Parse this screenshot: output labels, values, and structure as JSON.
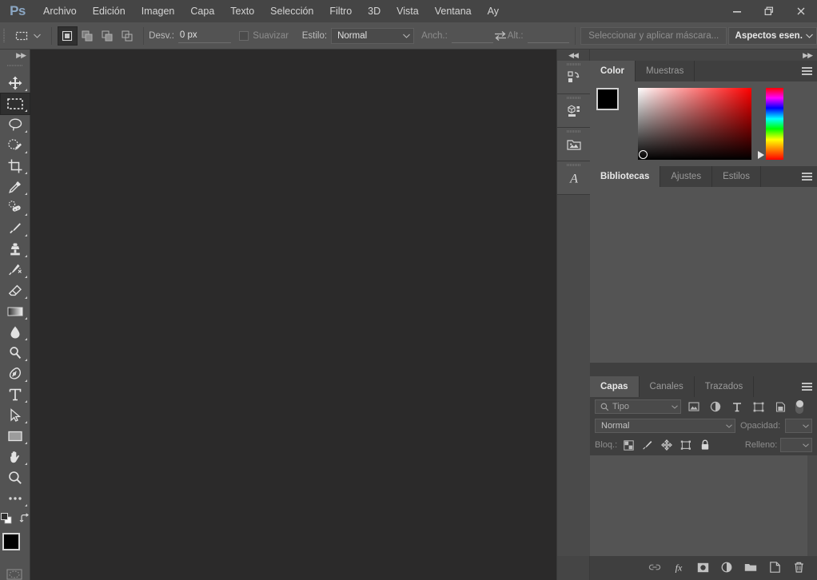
{
  "app": {
    "logo": "Ps",
    "accent_color": "#8ba7c4",
    "chrome_color": "#535353",
    "panel_color": "#545454",
    "canvas_color": "#2b2a2a"
  },
  "menubar": {
    "items": [
      {
        "label": "Archivo",
        "name": "menu-archivo"
      },
      {
        "label": "Edición",
        "name": "menu-edicion"
      },
      {
        "label": "Imagen",
        "name": "menu-imagen"
      },
      {
        "label": "Capa",
        "name": "menu-capa"
      },
      {
        "label": "Texto",
        "name": "menu-texto"
      },
      {
        "label": "Selección",
        "name": "menu-seleccion"
      },
      {
        "label": "Filtro",
        "name": "menu-filtro"
      },
      {
        "label": "3D",
        "name": "menu-3d"
      },
      {
        "label": "Vista",
        "name": "menu-vista"
      },
      {
        "label": "Ventana",
        "name": "menu-ventana"
      },
      {
        "label": "Ay",
        "name": "menu-ayuda"
      }
    ]
  },
  "window_controls": {
    "minimize": "minimize-icon",
    "restore": "restore-icon",
    "close": "close-icon"
  },
  "options_bar": {
    "tool_preset_icon": "rectangular-marquee-icon",
    "selection_modes": [
      {
        "name": "new-selection",
        "active": true
      },
      {
        "name": "add-to-selection",
        "active": false
      },
      {
        "name": "subtract-from-selection",
        "active": false
      },
      {
        "name": "intersect-selection",
        "active": false
      }
    ],
    "feather_label": "Desv.:",
    "feather_value": "0 px",
    "antialias_label": "Suavizar",
    "antialias_checked": false,
    "style_label": "Estilo:",
    "style_value": "Normal",
    "width_label": "Anch.:",
    "width_value": "",
    "height_label": "Alt.:",
    "height_value": "",
    "swap_icon": "swap-dimensions-icon",
    "select_and_mask_label": "Seleccionar y aplicar máscara...",
    "workspace_label": "Aspectos esen."
  },
  "toolbar": {
    "collapse_icon": "collapse-double-arrow-icon",
    "tools": [
      {
        "name": "move-tool",
        "label": "Mover",
        "selected": false,
        "has_flyout": true
      },
      {
        "name": "rectangular-marquee-tool",
        "label": "Marco rectangular",
        "selected": true,
        "has_flyout": true
      },
      {
        "name": "lasso-tool",
        "label": "Lazo",
        "selected": false,
        "has_flyout": true
      },
      {
        "name": "quick-selection-tool",
        "label": "Selección rápida",
        "selected": false,
        "has_flyout": true
      },
      {
        "name": "crop-tool",
        "label": "Recortar",
        "selected": false,
        "has_flyout": true
      },
      {
        "name": "eyedropper-tool",
        "label": "Cuentagotas",
        "selected": false,
        "has_flyout": true
      },
      {
        "name": "healing-brush-tool",
        "label": "Pincel corrector",
        "selected": false,
        "has_flyout": true
      },
      {
        "name": "brush-tool",
        "label": "Pincel",
        "selected": false,
        "has_flyout": true
      },
      {
        "name": "clone-stamp-tool",
        "label": "Tampón de clonar",
        "selected": false,
        "has_flyout": true
      },
      {
        "name": "history-brush-tool",
        "label": "Pincel de historia",
        "selected": false,
        "has_flyout": true
      },
      {
        "name": "eraser-tool",
        "label": "Borrador",
        "selected": false,
        "has_flyout": true
      },
      {
        "name": "gradient-tool",
        "label": "Degradado",
        "selected": false,
        "has_flyout": true
      },
      {
        "name": "blur-tool",
        "label": "Desenfocar",
        "selected": false,
        "has_flyout": true
      },
      {
        "name": "dodge-tool",
        "label": "Sobreexponer",
        "selected": false,
        "has_flyout": true
      },
      {
        "name": "pen-tool",
        "label": "Pluma",
        "selected": false,
        "has_flyout": true
      },
      {
        "name": "type-tool",
        "label": "Texto",
        "selected": false,
        "has_flyout": true
      },
      {
        "name": "path-selection-tool",
        "label": "Selección de trazado",
        "selected": false,
        "has_flyout": true
      },
      {
        "name": "rectangle-tool",
        "label": "Rectángulo",
        "selected": false,
        "has_flyout": true
      },
      {
        "name": "hand-tool",
        "label": "Mano",
        "selected": false,
        "has_flyout": true
      },
      {
        "name": "zoom-tool",
        "label": "Zoom",
        "selected": false,
        "has_flyout": false
      },
      {
        "name": "edit-toolbar-tool",
        "label": "Editar barra de herramientas",
        "selected": false,
        "has_flyout": true
      }
    ],
    "default_colors_icon": "default-colors-icon",
    "swap_colors_icon": "swap-colors-icon",
    "foreground_color": "#000000",
    "background_color": "#ffffff",
    "quickmask_icon": "quick-mask-icon"
  },
  "mini_dock": {
    "collapse_icon": "expand-double-arrow-icon",
    "items": [
      {
        "name": "history-panel-icon",
        "label": "Historia"
      },
      {
        "name": "3d-panel-icon",
        "label": "3D"
      },
      {
        "name": "libraries-panel-icon",
        "label": "Bibliotecas"
      },
      {
        "name": "character-panel-icon",
        "label": "Carácter"
      }
    ]
  },
  "panels": {
    "collapse_icon": "collapse-double-arrow-icon",
    "color_group": {
      "tabs": [
        {
          "label": "Color",
          "active": true,
          "name": "tab-color"
        },
        {
          "label": "Muestras",
          "active": false,
          "name": "tab-muestras"
        }
      ],
      "menu_icon": "panel-menu-icon",
      "foreground_color": "#000000",
      "background_color": "#ffffff",
      "field_hue": "#ff0000"
    },
    "libraries_group": {
      "tabs": [
        {
          "label": "Bibliotecas",
          "active": true,
          "name": "tab-bibliotecas"
        },
        {
          "label": "Ajustes",
          "active": false,
          "name": "tab-ajustes"
        },
        {
          "label": "Estilos",
          "active": false,
          "name": "tab-estilos"
        }
      ],
      "menu_icon": "panel-menu-icon"
    },
    "layers_group": {
      "tabs": [
        {
          "label": "Capas",
          "active": true,
          "name": "tab-capas"
        },
        {
          "label": "Canales",
          "active": false,
          "name": "tab-canales"
        },
        {
          "label": "Trazados",
          "active": false,
          "name": "tab-trazados"
        }
      ],
      "menu_icon": "panel-menu-icon",
      "filter_label": "Tipo",
      "filter_icons": [
        {
          "name": "filter-pixel-layers-icon"
        },
        {
          "name": "filter-adjustment-layers-icon"
        },
        {
          "name": "filter-type-layers-icon"
        },
        {
          "name": "filter-shape-layers-icon"
        },
        {
          "name": "filter-smart-object-layers-icon"
        }
      ],
      "filter_toggle": "filter-enable-toggle",
      "blend_mode": "Normal",
      "opacity_label": "Opacidad:",
      "opacity_value": "",
      "lock_label": "Bloq.:",
      "lock_icons": [
        {
          "name": "lock-transparent-pixels-icon"
        },
        {
          "name": "lock-image-pixels-icon"
        },
        {
          "name": "lock-position-icon"
        },
        {
          "name": "lock-artboard-nesting-icon"
        },
        {
          "name": "lock-all-icon"
        }
      ],
      "fill_label": "Relleno:",
      "fill_value": "",
      "footer_buttons": [
        {
          "name": "link-layers-button",
          "glyph": "link-icon"
        },
        {
          "name": "layer-style-button",
          "glyph": "fx-icon"
        },
        {
          "name": "layer-mask-button",
          "glyph": "mask-icon"
        },
        {
          "name": "new-fill-adjustment-button",
          "glyph": "adjustment-icon"
        },
        {
          "name": "new-group-button",
          "glyph": "folder-icon"
        },
        {
          "name": "new-layer-button",
          "glyph": "new-layer-icon"
        },
        {
          "name": "delete-layer-button",
          "glyph": "trash-icon"
        }
      ]
    }
  }
}
